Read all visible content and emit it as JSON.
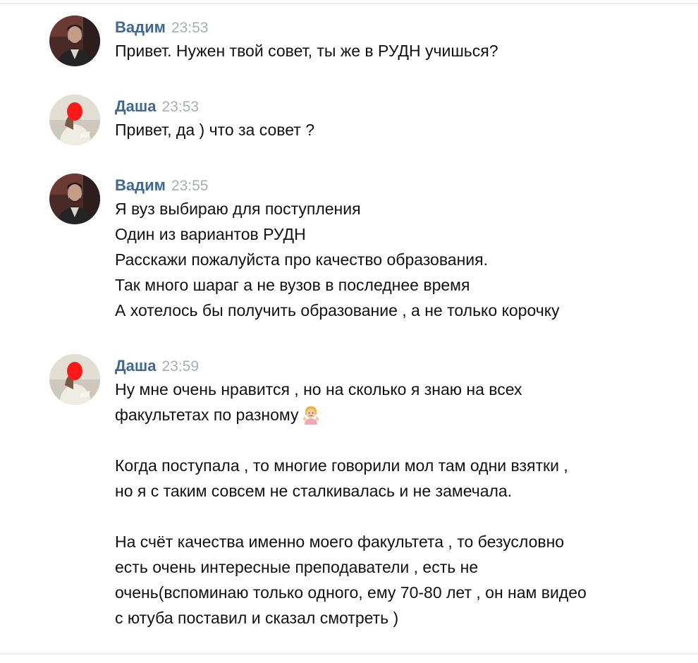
{
  "messages": [
    {
      "author": "Вадим",
      "time": "23:53",
      "lines": [
        "Привет. Нужен твой совет, ты же в РУДН учишься?"
      ]
    },
    {
      "author": "Даша",
      "time": "23:53",
      "lines": [
        "Привет, да ) что за совет ?"
      ]
    },
    {
      "author": "Вадим",
      "time": "23:55",
      "lines": [
        "Я вуз выбираю для поступления",
        "Один из вариантов РУДН",
        "Расскажи пожалуйста про качество образования.",
        "Так много шараг а не вузов в последнее время",
        "А хотелось бы получить образование , а не только корочку"
      ]
    },
    {
      "author": "Даша",
      "time": "23:59",
      "lines": [
        "Ну мне очень нравится , но на сколько я знаю на всех",
        "факультетах по разному",
        "",
        "Когда поступала , то многие говорили мол там одни взятки ,",
        "но я с таким совсем не сталкивалась и не замечала.",
        "",
        "На счёт качества именно моего факультета , то безусловно",
        "есть очень интересные преподаватели , есть не",
        "очень(вспоминаю только одного, ему 70-80 лет , он нам видео",
        "с ютуба поставил и сказал смотреть )"
      ],
      "emoji": "person-shrugging-emoji"
    }
  ],
  "colors": {
    "author": "#3f6794",
    "time": "#a8adb4",
    "text": "#111111",
    "censor_mark": "#ff1a1a"
  }
}
